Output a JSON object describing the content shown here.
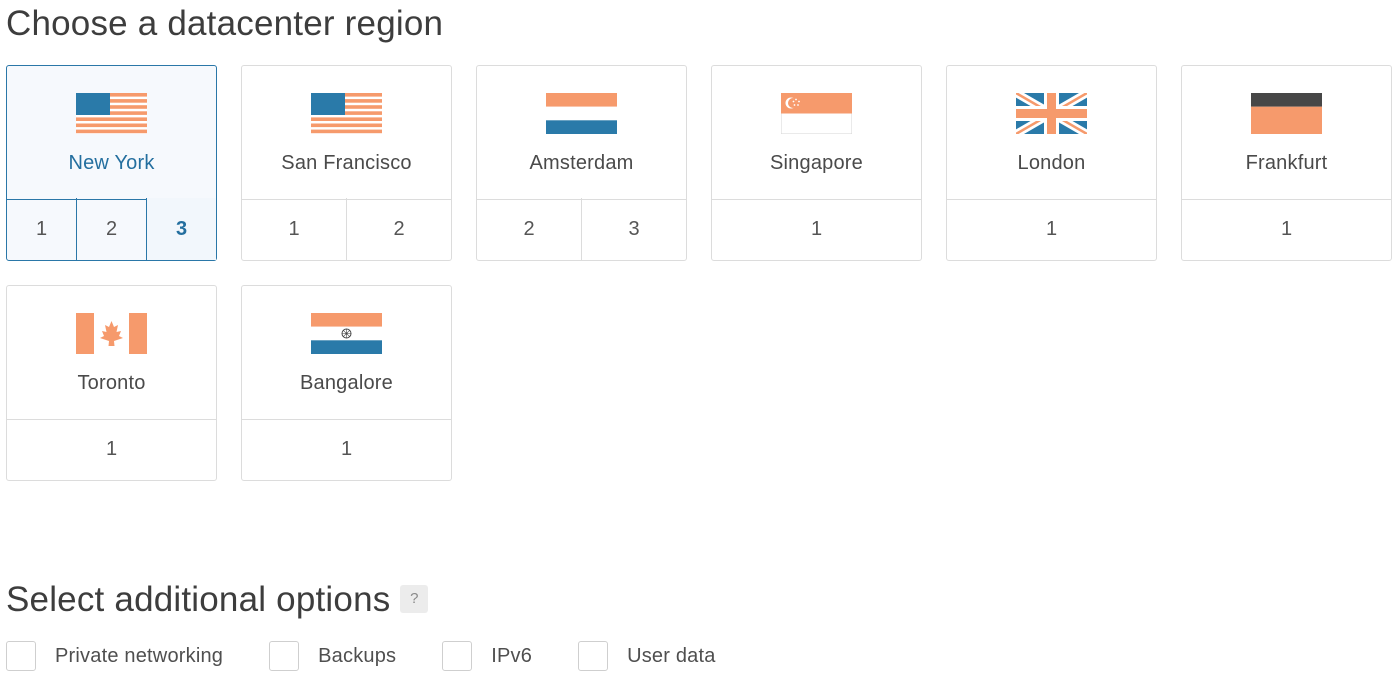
{
  "region_section": {
    "title": "Choose a datacenter region"
  },
  "regions": [
    {
      "city": "New York",
      "flag": "usa-flag-icon",
      "datacenters": [
        "1",
        "2",
        "3"
      ],
      "selected": true,
      "active_datacenter": "3"
    },
    {
      "city": "San Francisco",
      "flag": "usa-flag-icon",
      "datacenters": [
        "1",
        "2"
      ]
    },
    {
      "city": "Amsterdam",
      "flag": "netherlands-flag-icon",
      "datacenters": [
        "2",
        "3"
      ]
    },
    {
      "city": "Singapore",
      "flag": "singapore-flag-icon",
      "datacenters": [
        "1"
      ]
    },
    {
      "city": "London",
      "flag": "uk-flag-icon",
      "datacenters": [
        "1"
      ]
    },
    {
      "city": "Frankfurt",
      "flag": "germany-flag-icon",
      "datacenters": [
        "1"
      ]
    },
    {
      "city": "Toronto",
      "flag": "canada-flag-icon",
      "datacenters": [
        "1"
      ]
    },
    {
      "city": "Bangalore",
      "flag": "india-flag-icon",
      "datacenters": [
        "1"
      ]
    }
  ],
  "options_section": {
    "title": "Select additional options",
    "help": "?",
    "options": [
      {
        "label": "Private networking",
        "checked": false
      },
      {
        "label": "Backups",
        "checked": false
      },
      {
        "label": "IPv6",
        "checked": false
      },
      {
        "label": "User data",
        "checked": false
      }
    ]
  },
  "colors": {
    "accent": "#2a77a8",
    "flag_orange": "#f69a6c",
    "flag_blue": "#2a7aa9",
    "flag_dark": "#474747",
    "border": "#dcdcdc"
  }
}
